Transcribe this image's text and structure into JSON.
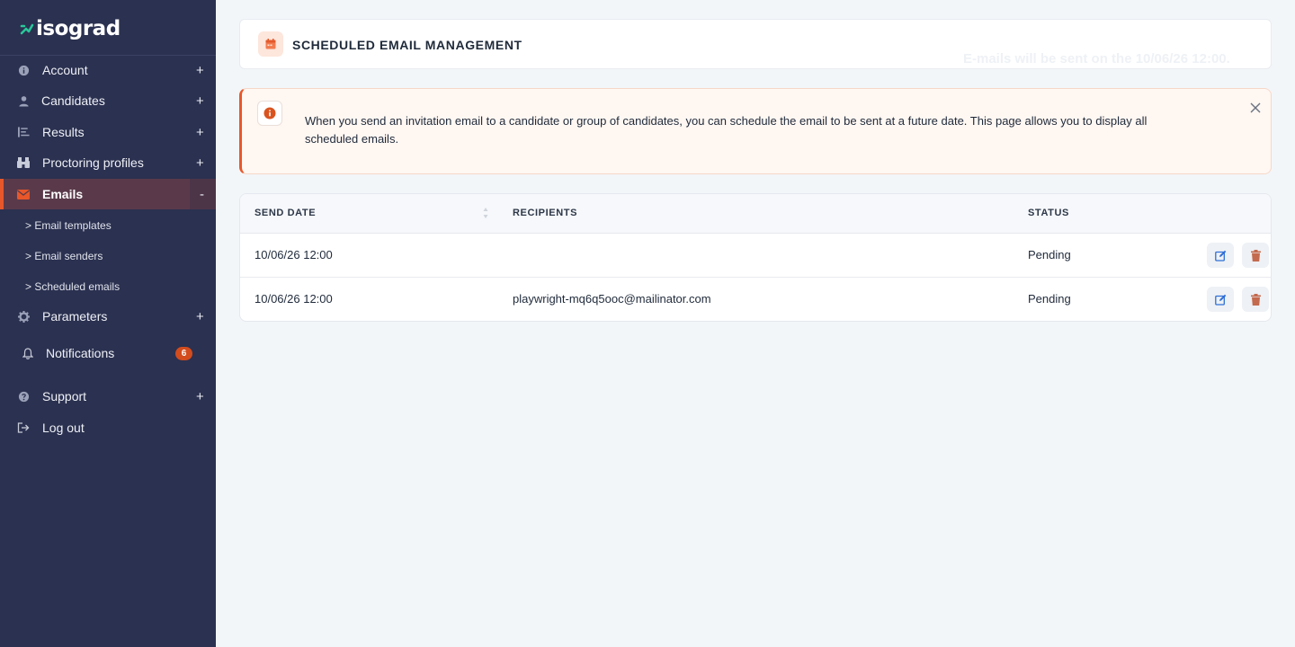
{
  "brand": {
    "name": "isograd"
  },
  "sidebar": {
    "items": [
      {
        "label": "Account",
        "toggle": "+"
      },
      {
        "label": "Candidates",
        "toggle": "+"
      },
      {
        "label": "Results",
        "toggle": "+"
      },
      {
        "label": "Proctoring profiles",
        "toggle": "+"
      },
      {
        "label": "Emails",
        "toggle": "-"
      },
      {
        "label": "Parameters",
        "toggle": "+"
      },
      {
        "label": "Notifications",
        "badge": "6"
      },
      {
        "label": "Support",
        "toggle": "+"
      },
      {
        "label": "Log out"
      }
    ],
    "email_sub_items": [
      "> Email templates",
      "> Email senders",
      "> Scheduled emails"
    ]
  },
  "header": {
    "title": "SCHEDULED EMAIL MANAGEMENT",
    "toast": "E-mails will be sent on the 10/06/26 12:00."
  },
  "info": {
    "text": "When you send an invitation email to a candidate or group of candidates, you can schedule the email to be sent at a future date. This page allows you to display all scheduled emails."
  },
  "table": {
    "columns": [
      "SEND DATE",
      "RECIPIENTS",
      "STATUS"
    ],
    "rows": [
      {
        "send_date": "10/06/26 12:00",
        "recipients": "",
        "status": "Pending"
      },
      {
        "send_date": "10/06/26 12:00",
        "recipients": "playwright-mq6q5ooc@mailinator.com",
        "status": "Pending"
      }
    ]
  },
  "colors": {
    "sidebar": "#2b3150",
    "accent": "#e8572a",
    "background": "#f3f6f9",
    "edit": "#2f6fd6",
    "delete": "#c46a4e"
  }
}
